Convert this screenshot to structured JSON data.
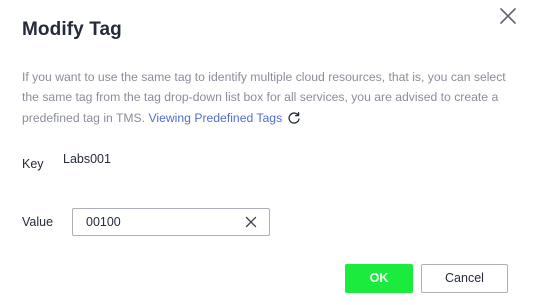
{
  "dialog": {
    "title": "Modify Tag",
    "close_icon": "close-icon"
  },
  "description": {
    "line1": "If you want to use the same tag to identify multiple cloud resources, that is, you can select",
    "line2": "the same tag from the tag drop-down list box for all services, you are advised to create a",
    "line3_prefix": "predefined tag in TMS. ",
    "link_text": "Viewing Predefined Tags",
    "refresh_icon": "refresh-icon"
  },
  "form": {
    "key_label": "Key",
    "key_value": "Labs001",
    "value_label": "Value",
    "value_input": "00100",
    "clear_icon": "clear-icon"
  },
  "footer": {
    "ok_label": "OK",
    "cancel_label": "Cancel"
  },
  "colors": {
    "ok_button": "#1aeb3c",
    "link": "#526ecc",
    "description_text": "#8a8e99"
  }
}
